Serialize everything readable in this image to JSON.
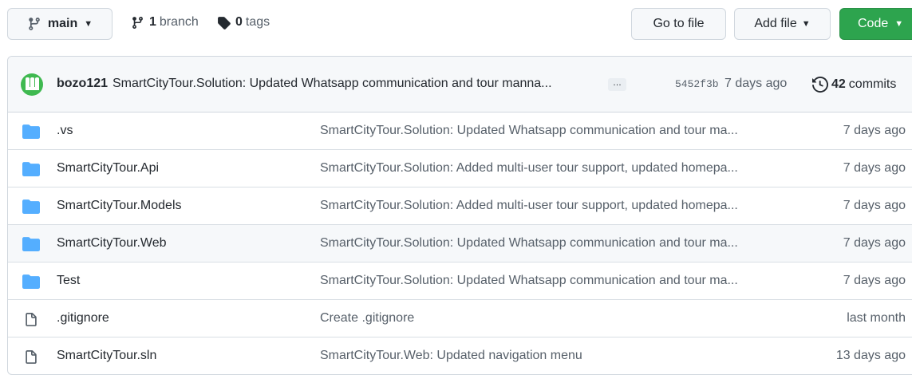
{
  "toolbar": {
    "branch_label": "main",
    "branch_count": "1",
    "branch_word": "branch",
    "tag_count": "0",
    "tag_word": "tags",
    "go_to_file": "Go to file",
    "add_file": "Add file",
    "code": "Code"
  },
  "latest_commit": {
    "author": "bozo121",
    "message": "SmartCityTour.Solution: Updated Whatsapp communication and tour manna...",
    "ellipsis": "…",
    "sha": "5452f3b",
    "time": "7 days ago",
    "commit_count": "42",
    "commit_word": "commits"
  },
  "files": [
    {
      "type": "folder",
      "name": ".vs",
      "commit": "SmartCityTour.Solution: Updated Whatsapp communication and tour ma...",
      "age": "7 days ago"
    },
    {
      "type": "folder",
      "name": "SmartCityTour.Api",
      "commit": "SmartCityTour.Solution: Added multi-user tour support, updated homepa...",
      "age": "7 days ago"
    },
    {
      "type": "folder",
      "name": "SmartCityTour.Models",
      "commit": "SmartCityTour.Solution: Added multi-user tour support, updated homepa...",
      "age": "7 days ago"
    },
    {
      "type": "folder",
      "name": "SmartCityTour.Web",
      "commit": "SmartCityTour.Solution: Updated Whatsapp communication and tour ma...",
      "age": "7 days ago"
    },
    {
      "type": "folder",
      "name": "Test",
      "commit": "SmartCityTour.Solution: Updated Whatsapp communication and tour ma...",
      "age": "7 days ago"
    },
    {
      "type": "file",
      "name": ".gitignore",
      "commit": "Create .gitignore",
      "age": "last month"
    },
    {
      "type": "file",
      "name": "SmartCityTour.sln",
      "commit": "SmartCityTour.Web: Updated navigation menu",
      "age": "13 days ago"
    }
  ],
  "colors": {
    "folder": "#54aeff",
    "code_button": "#2da44e",
    "avatar": "#3fb950"
  }
}
